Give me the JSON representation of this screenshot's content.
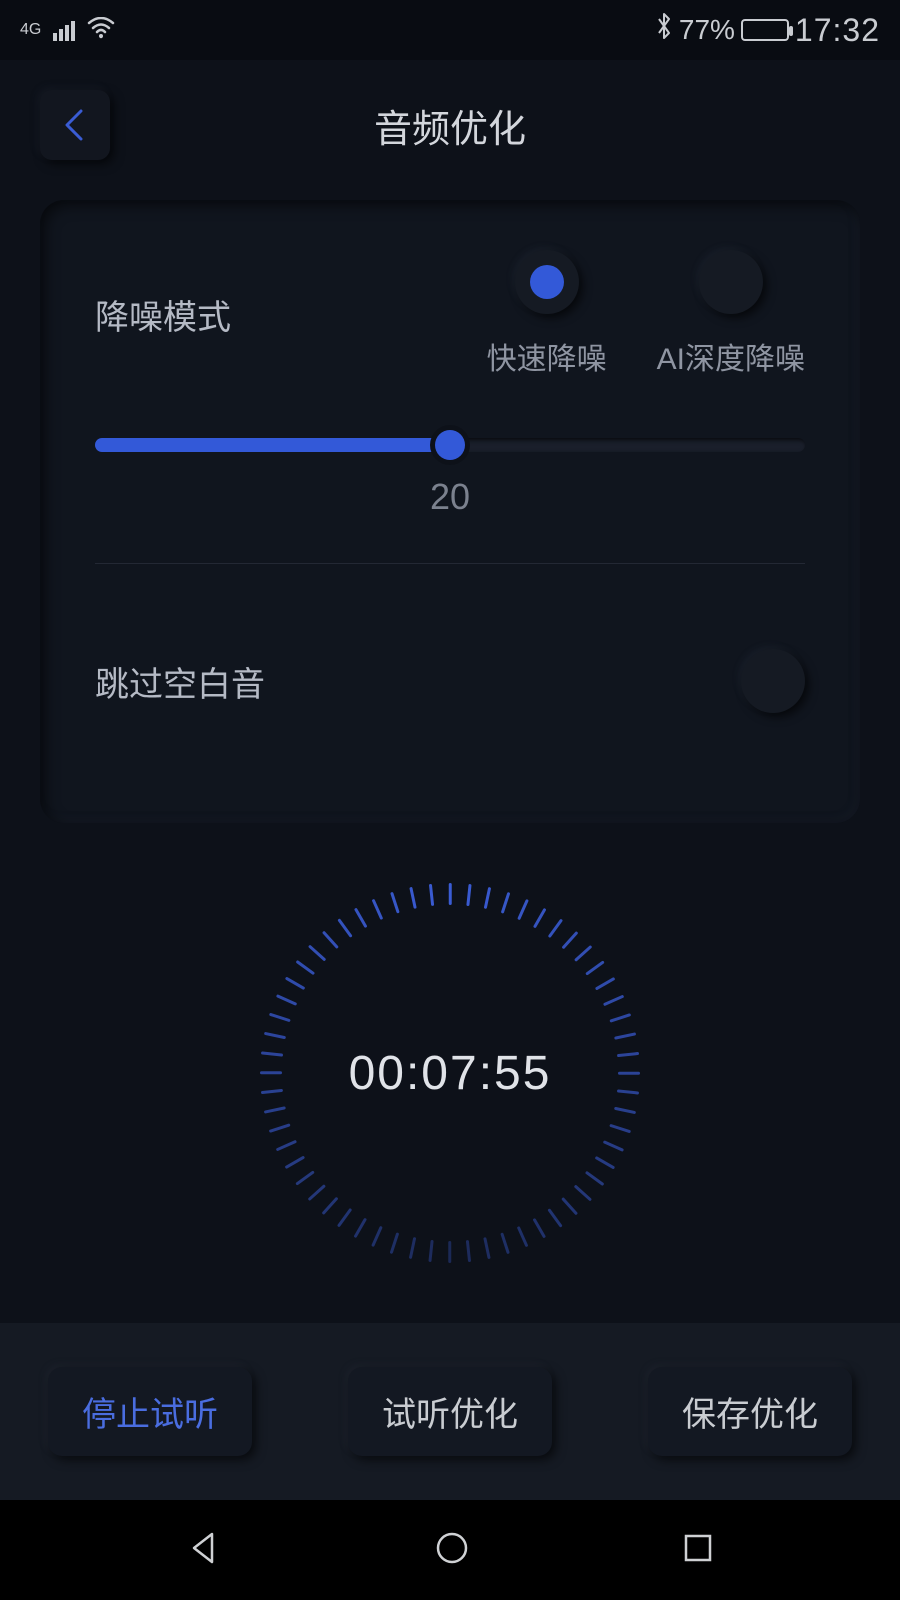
{
  "status": {
    "network": "4G",
    "battery_text": "77%",
    "time": "17:32"
  },
  "header": {
    "title": "音频优化"
  },
  "settings": {
    "noise_mode_label": "降噪模式",
    "option_fast": "快速降噪",
    "option_ai": "AI深度降噪",
    "slider_value": "20",
    "skip_silence_label": "跳过空白音"
  },
  "timer": {
    "display": "00:07:55"
  },
  "actions": {
    "stop_preview": "停止试听",
    "preview_opt": "试听优化",
    "save_opt": "保存优化"
  }
}
